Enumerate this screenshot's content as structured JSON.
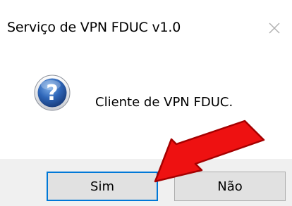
{
  "window": {
    "title": "Serviço de VPN FDUC v1.0",
    "close_icon": "close-x-icon"
  },
  "message": {
    "icon": "question-icon",
    "text": "Cliente de VPN FDUC."
  },
  "buttons": {
    "yes_label": "Sim",
    "no_label": "Não",
    "default": "yes"
  },
  "annotation": {
    "type": "arrow",
    "color": "#ee1111",
    "outline_color": "#a50000",
    "points_to": "Sim"
  },
  "colors": {
    "focus_border": "#0078d7",
    "footer_bg": "#f0f0f0",
    "button_bg": "#e1e1e1",
    "icon_blue": "#2a5fa8"
  }
}
